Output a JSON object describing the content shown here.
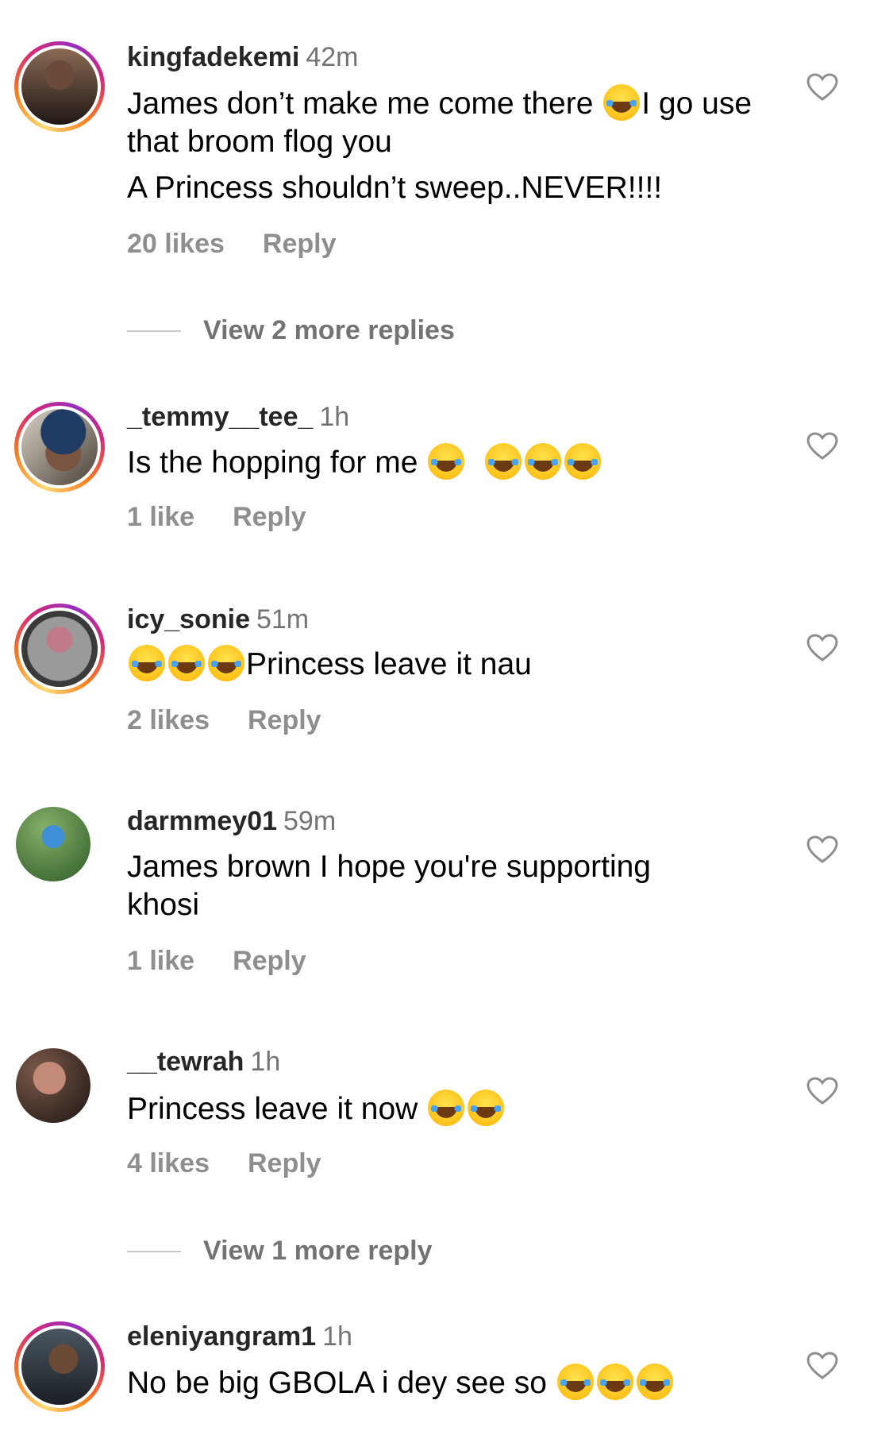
{
  "comments": [
    {
      "username": "kingfadekemi",
      "time": "42m",
      "lines": [
        "James don’t make me come there 😂I go use that broom flog you",
        "A Princess shouldn’t sweep..NEVER!!!!"
      ],
      "likes": "20 likes",
      "reply_label": "Reply",
      "view_replies": "View 2 more replies",
      "avatar_color": "#3a2a24"
    },
    {
      "username": "_temmy__tee_",
      "time": "1h",
      "lines": [
        "Is the hopping for me 😂 😂😂😂"
      ],
      "likes": "1 like",
      "reply_label": "Reply",
      "avatar_color": "#2a3a56"
    },
    {
      "username": "icy_sonie",
      "time": "51m",
      "lines": [
        "😂😂😂Princess leave it nau"
      ],
      "likes": "2 likes",
      "reply_label": "Reply",
      "avatar_color": "#5a5a5a"
    },
    {
      "username": "darmmey01",
      "time": "59m",
      "lines": [
        "James brown I hope you're supporting khosi"
      ],
      "likes": "1 like",
      "reply_label": "Reply",
      "avatar_color": "#4f7a3c"
    },
    {
      "username": "__tewrah",
      "time": "1h",
      "lines": [
        "Princess leave it now 😂😂"
      ],
      "likes": "4 likes",
      "reply_label": "Reply",
      "view_replies": "View 1 more reply",
      "avatar_color": "#3b2a22"
    },
    {
      "username": "eleniyangram1",
      "time": "1h",
      "lines": [
        "No be big GBOLA i dey see so 😂😂😂"
      ],
      "avatar_color": "#30363c"
    }
  ],
  "icons": {
    "like": "heart-outline-icon",
    "emoji": "face-with-tears-of-joy"
  },
  "colors": {
    "username": "#262626",
    "secondary": "#8e8e8e",
    "story_ring": "#d62976"
  }
}
